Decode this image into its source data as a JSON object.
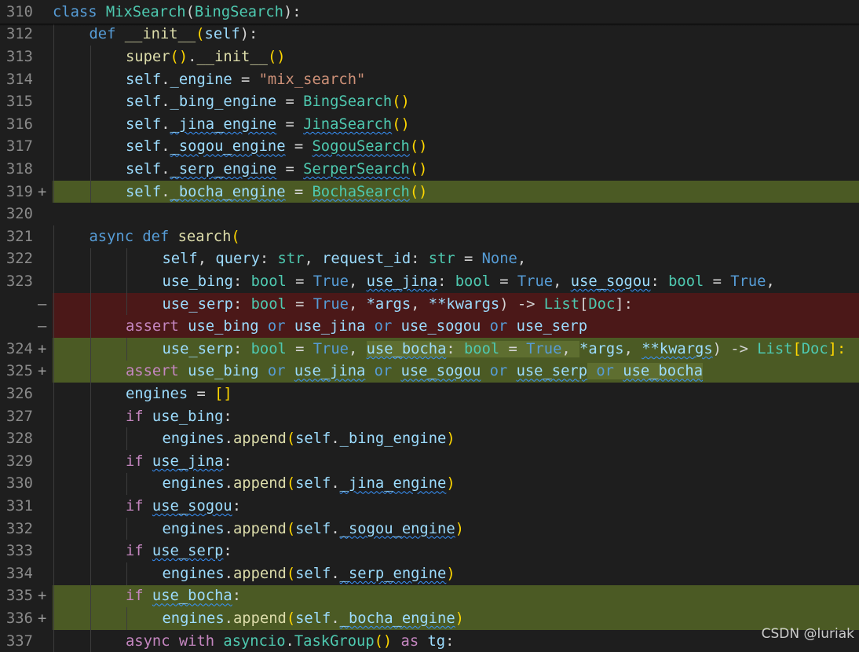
{
  "editor": {
    "lines": [
      {
        "num": "310",
        "marker": "",
        "type": "normal",
        "indent": 0,
        "tokens": [
          [
            "class ",
            "k"
          ],
          [
            "MixSearch",
            "cls"
          ],
          [
            "(",
            "p"
          ],
          [
            "BingSearch",
            "cls"
          ],
          [
            "):",
            "p"
          ]
        ]
      },
      {
        "num": "312",
        "marker": "",
        "type": "normal",
        "indent": 1,
        "tokens": [
          [
            "def ",
            "k"
          ],
          [
            "__init__",
            "fn"
          ],
          [
            "(",
            "br"
          ],
          [
            "self",
            "v"
          ],
          [
            "):",
            "p"
          ]
        ]
      },
      {
        "num": "313",
        "marker": "",
        "type": "normal",
        "indent": 2,
        "tokens": [
          [
            "super",
            "fn"
          ],
          [
            "()",
            "br"
          ],
          [
            ".",
            "p"
          ],
          [
            "__init__",
            "fn"
          ],
          [
            "()",
            "br"
          ]
        ]
      },
      {
        "num": "314",
        "marker": "",
        "type": "normal",
        "indent": 2,
        "tokens": [
          [
            "self",
            "v"
          ],
          [
            ".",
            "p"
          ],
          [
            "_engine",
            "v"
          ],
          [
            " = ",
            "p"
          ],
          [
            "\"mix_search\"",
            "s"
          ]
        ]
      },
      {
        "num": "315",
        "marker": "",
        "type": "normal",
        "indent": 2,
        "tokens": [
          [
            "self",
            "v"
          ],
          [
            ".",
            "p"
          ],
          [
            "_bing_engine",
            "v"
          ],
          [
            " = ",
            "p"
          ],
          [
            "BingSearch",
            "cls"
          ],
          [
            "()",
            "br"
          ]
        ]
      },
      {
        "num": "316",
        "marker": "",
        "type": "normal",
        "indent": 2,
        "tokens": [
          [
            "self",
            "v"
          ],
          [
            ".",
            "p"
          ],
          [
            "_jina_engine",
            "v",
            "sq"
          ],
          [
            " = ",
            "p"
          ],
          [
            "JinaSearch",
            "cls",
            "sq"
          ],
          [
            "()",
            "br"
          ]
        ]
      },
      {
        "num": "317",
        "marker": "",
        "type": "normal",
        "indent": 2,
        "tokens": [
          [
            "self",
            "v"
          ],
          [
            ".",
            "p"
          ],
          [
            "_sogou_engine",
            "v",
            "sq"
          ],
          [
            " = ",
            "p"
          ],
          [
            "SogouSearch",
            "cls",
            "sq"
          ],
          [
            "()",
            "br"
          ]
        ]
      },
      {
        "num": "318",
        "marker": "",
        "type": "normal",
        "indent": 2,
        "tokens": [
          [
            "self",
            "v"
          ],
          [
            ".",
            "p"
          ],
          [
            "_serp_engine",
            "v",
            "sq"
          ],
          [
            " = ",
            "p"
          ],
          [
            "SerperSearch",
            "cls",
            "sq"
          ],
          [
            "()",
            "br"
          ]
        ]
      },
      {
        "num": "319",
        "marker": "+",
        "type": "add",
        "indent": 2,
        "tokens": [
          [
            "self",
            "v"
          ],
          [
            ".",
            "p"
          ],
          [
            "_bocha_engine",
            "v",
            "sq"
          ],
          [
            " = ",
            "p"
          ],
          [
            "BochaSearch",
            "cls",
            "sq"
          ],
          [
            "()",
            "br"
          ]
        ]
      },
      {
        "num": "320",
        "marker": "",
        "type": "normal",
        "indent": 0,
        "tokens": []
      },
      {
        "num": "321",
        "marker": "",
        "type": "normal",
        "indent": 1,
        "tokens": [
          [
            "async ",
            "k"
          ],
          [
            "def ",
            "k"
          ],
          [
            "search",
            "fn"
          ],
          [
            "(",
            "br"
          ]
        ]
      },
      {
        "num": "322",
        "marker": "",
        "type": "normal",
        "indent": 3,
        "tokens": [
          [
            "self",
            "v"
          ],
          [
            ", ",
            "p"
          ],
          [
            "query",
            "v"
          ],
          [
            ": ",
            "p"
          ],
          [
            "str",
            "cls"
          ],
          [
            ", ",
            "p"
          ],
          [
            "request_id",
            "v"
          ],
          [
            ": ",
            "p"
          ],
          [
            "str",
            "cls"
          ],
          [
            " = ",
            "p"
          ],
          [
            "None",
            "k"
          ],
          [
            ",",
            "p"
          ]
        ]
      },
      {
        "num": "323",
        "marker": "",
        "type": "normal",
        "indent": 3,
        "tokens": [
          [
            "use_bing",
            "v"
          ],
          [
            ": ",
            "p"
          ],
          [
            "bool",
            "cls"
          ],
          [
            " = ",
            "p"
          ],
          [
            "True",
            "k"
          ],
          [
            ", ",
            "p"
          ],
          [
            "use_jina",
            "v",
            "sq"
          ],
          [
            ": ",
            "p"
          ],
          [
            "bool",
            "cls"
          ],
          [
            " = ",
            "p"
          ],
          [
            "True",
            "k"
          ],
          [
            ", ",
            "p"
          ],
          [
            "use_sogou",
            "v",
            "sq"
          ],
          [
            ": ",
            "p"
          ],
          [
            "bool",
            "cls"
          ],
          [
            " = ",
            "p"
          ],
          [
            "True",
            "k"
          ],
          [
            ",",
            "p"
          ]
        ]
      },
      {
        "num": "",
        "marker": "—",
        "type": "del",
        "indent": 3,
        "tokens": [
          [
            "use_serp",
            "v"
          ],
          [
            ": ",
            "p"
          ],
          [
            "bool",
            "cls"
          ],
          [
            " = ",
            "p"
          ],
          [
            "True",
            "k"
          ],
          [
            ", ",
            "p"
          ],
          [
            "*args",
            "v"
          ],
          [
            ", ",
            "p"
          ],
          [
            "**kwargs",
            "v"
          ],
          [
            ") -> ",
            "p"
          ],
          [
            "List",
            "cls"
          ],
          [
            "[",
            "p"
          ],
          [
            "Doc",
            "cls"
          ],
          [
            "]:",
            "p"
          ]
        ]
      },
      {
        "num": "",
        "marker": "—",
        "type": "del",
        "indent": 2,
        "tokens": [
          [
            "assert ",
            "c"
          ],
          [
            "use_bing",
            "v"
          ],
          [
            " or ",
            "k"
          ],
          [
            "use_jina",
            "v"
          ],
          [
            " or ",
            "k"
          ],
          [
            "use_sogou",
            "v"
          ],
          [
            " or ",
            "k"
          ],
          [
            "use_serp",
            "v"
          ]
        ]
      },
      {
        "num": "324",
        "marker": "+",
        "type": "add",
        "indent": 3,
        "tokens": [
          [
            "use_serp",
            "v"
          ],
          [
            ": ",
            "p"
          ],
          [
            "bool",
            "cls"
          ],
          [
            " = ",
            "p"
          ],
          [
            "True",
            "k"
          ],
          [
            ", ",
            "p"
          ],
          [
            "use_bocha",
            "v",
            "sq hl"
          ],
          [
            ": ",
            "p",
            "hl"
          ],
          [
            "bool",
            "cls",
            "hl"
          ],
          [
            " = ",
            "p",
            "hl"
          ],
          [
            "True",
            "k",
            "hl"
          ],
          [
            ", ",
            "p",
            "hl"
          ],
          [
            "*args",
            "v"
          ],
          [
            ", ",
            "p"
          ],
          [
            "**kwargs",
            "v",
            "sq"
          ],
          [
            ") -> ",
            "p"
          ],
          [
            "List",
            "cls"
          ],
          [
            "[",
            "br"
          ],
          [
            "Doc",
            "cls"
          ],
          [
            "]:",
            "br"
          ]
        ]
      },
      {
        "num": "325",
        "marker": "+",
        "type": "add",
        "indent": 2,
        "tokens": [
          [
            "assert ",
            "c"
          ],
          [
            "use_bing",
            "v"
          ],
          [
            " or ",
            "k"
          ],
          [
            "use_jina",
            "v",
            "sq"
          ],
          [
            " or ",
            "k"
          ],
          [
            "use_sogou",
            "v",
            "sq"
          ],
          [
            " or ",
            "k"
          ],
          [
            "use_serp",
            "v",
            "sq"
          ],
          [
            " or ",
            "k",
            "hl"
          ],
          [
            "use_bocha",
            "v",
            "sq hl"
          ]
        ]
      },
      {
        "num": "326",
        "marker": "",
        "type": "normal",
        "indent": 2,
        "tokens": [
          [
            "engines",
            "v"
          ],
          [
            " = ",
            "p"
          ],
          [
            "[]",
            "br"
          ]
        ]
      },
      {
        "num": "327",
        "marker": "",
        "type": "normal",
        "indent": 2,
        "tokens": [
          [
            "if ",
            "c"
          ],
          [
            "use_bing",
            "v"
          ],
          [
            ":",
            "p"
          ]
        ]
      },
      {
        "num": "328",
        "marker": "",
        "type": "normal",
        "indent": 3,
        "tokens": [
          [
            "engines",
            "v"
          ],
          [
            ".",
            "p"
          ],
          [
            "append",
            "fn"
          ],
          [
            "(",
            "br"
          ],
          [
            "self",
            "v"
          ],
          [
            ".",
            "p"
          ],
          [
            "_bing_engine",
            "v"
          ],
          [
            ")",
            "br"
          ]
        ]
      },
      {
        "num": "329",
        "marker": "",
        "type": "normal",
        "indent": 2,
        "tokens": [
          [
            "if ",
            "c"
          ],
          [
            "use_jina",
            "v",
            "sq"
          ],
          [
            ":",
            "p"
          ]
        ]
      },
      {
        "num": "330",
        "marker": "",
        "type": "normal",
        "indent": 3,
        "tokens": [
          [
            "engines",
            "v"
          ],
          [
            ".",
            "p"
          ],
          [
            "append",
            "fn"
          ],
          [
            "(",
            "br"
          ],
          [
            "self",
            "v"
          ],
          [
            ".",
            "p"
          ],
          [
            "_jina_engine",
            "v",
            "sq"
          ],
          [
            ")",
            "br"
          ]
        ]
      },
      {
        "num": "331",
        "marker": "",
        "type": "normal",
        "indent": 2,
        "tokens": [
          [
            "if ",
            "c"
          ],
          [
            "use_sogou",
            "v",
            "sq"
          ],
          [
            ":",
            "p"
          ]
        ]
      },
      {
        "num": "332",
        "marker": "",
        "type": "normal",
        "indent": 3,
        "tokens": [
          [
            "engines",
            "v"
          ],
          [
            ".",
            "p"
          ],
          [
            "append",
            "fn"
          ],
          [
            "(",
            "br"
          ],
          [
            "self",
            "v"
          ],
          [
            ".",
            "p"
          ],
          [
            "_sogou_engine",
            "v",
            "sq"
          ],
          [
            ")",
            "br"
          ]
        ]
      },
      {
        "num": "333",
        "marker": "",
        "type": "normal",
        "indent": 2,
        "tokens": [
          [
            "if ",
            "c"
          ],
          [
            "use_serp",
            "v",
            "sq"
          ],
          [
            ":",
            "p"
          ]
        ]
      },
      {
        "num": "334",
        "marker": "",
        "type": "normal",
        "indent": 3,
        "tokens": [
          [
            "engines",
            "v"
          ],
          [
            ".",
            "p"
          ],
          [
            "append",
            "fn"
          ],
          [
            "(",
            "br"
          ],
          [
            "self",
            "v"
          ],
          [
            ".",
            "p"
          ],
          [
            "_serp_engine",
            "v",
            "sq"
          ],
          [
            ")",
            "br"
          ]
        ]
      },
      {
        "num": "335",
        "marker": "+",
        "type": "add",
        "indent": 2,
        "tokens": [
          [
            "if ",
            "c"
          ],
          [
            "use_bocha",
            "v",
            "sq"
          ],
          [
            ":",
            "p"
          ]
        ]
      },
      {
        "num": "336",
        "marker": "+",
        "type": "add",
        "indent": 3,
        "tokens": [
          [
            "engines",
            "v"
          ],
          [
            ".",
            "p"
          ],
          [
            "append",
            "fn"
          ],
          [
            "(",
            "br"
          ],
          [
            "self",
            "v"
          ],
          [
            ".",
            "p"
          ],
          [
            "_bocha_engine",
            "v",
            "sq"
          ],
          [
            ")",
            "br"
          ]
        ]
      },
      {
        "num": "337",
        "marker": "",
        "type": "normal",
        "indent": 2,
        "tokens": [
          [
            "async ",
            "c"
          ],
          [
            "with ",
            "c"
          ],
          [
            "asyncio",
            "cls"
          ],
          [
            ".",
            "p"
          ],
          [
            "TaskGroup",
            "cls"
          ],
          [
            "()",
            "br"
          ],
          [
            " as ",
            "c"
          ],
          [
            "tg",
            "v"
          ],
          [
            ":",
            "p"
          ]
        ]
      }
    ]
  },
  "watermark": "CSDN @luriak"
}
